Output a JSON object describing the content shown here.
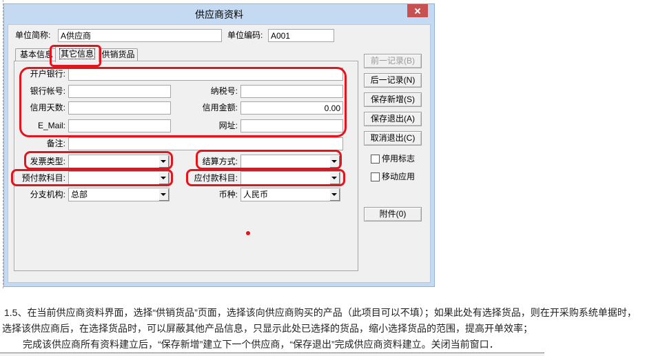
{
  "window": {
    "title": "供应商资料"
  },
  "header": {
    "short_name": {
      "label": "单位简称:",
      "value": "A供应商"
    },
    "code": {
      "label": "单位编码:",
      "value": "A001"
    }
  },
  "tabs": [
    {
      "label": "基本信息",
      "active": false
    },
    {
      "label": "其它信息",
      "active": true
    },
    {
      "label": "供销货品",
      "active": false
    }
  ],
  "form": {
    "bank": {
      "label": "开户银行:",
      "value": ""
    },
    "account": {
      "label": "银行帐号:",
      "value": ""
    },
    "tax_no": {
      "label": "纳税号:",
      "value": ""
    },
    "credit_days": {
      "label": "信用天数:",
      "value": ""
    },
    "credit_amount": {
      "label": "信用金额:",
      "value": "0.00"
    },
    "email": {
      "label": "E_Mail:",
      "value": ""
    },
    "website": {
      "label": "网址:",
      "value": ""
    },
    "remark": {
      "label": "备注:",
      "value": ""
    },
    "invoice_type": {
      "label": "发票类型:",
      "value": ""
    },
    "settlement": {
      "label": "结算方式:",
      "value": ""
    },
    "prepaid_account": {
      "label": "预付款科目:",
      "value": ""
    },
    "payable_account": {
      "label": "应付款科目:",
      "value": ""
    },
    "branch": {
      "label": "分支机构:",
      "value": "总部"
    },
    "currency": {
      "label": "币种:",
      "value": "人民币"
    }
  },
  "buttons": {
    "prev": {
      "label": "前一记录(B)",
      "enabled": false
    },
    "next": {
      "label": "后一记录(N)",
      "enabled": true
    },
    "save_new": {
      "label": "保存新增(S)",
      "enabled": true
    },
    "save_exit": {
      "label": "保存退出(A)",
      "enabled": true
    },
    "cancel_exit": {
      "label": "取消退出(C)",
      "enabled": true
    },
    "attachment": {
      "label": "附件(0)",
      "enabled": true
    }
  },
  "checkboxes": {
    "disabled_flag": {
      "label": "停用标志",
      "checked": false
    },
    "mobile_app": {
      "label": "移动应用",
      "checked": false
    }
  },
  "document": {
    "lines": [
      "1.5、在当前供应商资料界面，选择“供销货品”页面，选择该向供应商购买的产品（此项目可以不填）；如果此处有选择货品，则在开采购系统单据时，",
      "选择该供应商后，在选择货品时，可以屏蔽其他产品信息，只显示此处已选择的货品，缩小选择货品的范围，提高开单效率；",
      "完成该供应商所有资料建立后，“保存新增”建立下一个供应商，“保存退出”完成供应商资料建立。关闭当前窗口．"
    ]
  },
  "colors": {
    "frame": "#c4daf2",
    "close": "#c75050",
    "annot": "#e3141c",
    "face": "#f0f0f0"
  },
  "icons": {
    "close": "close-icon",
    "dropdown": "chevron-down-icon",
    "checkbox": "checkbox-icon"
  }
}
